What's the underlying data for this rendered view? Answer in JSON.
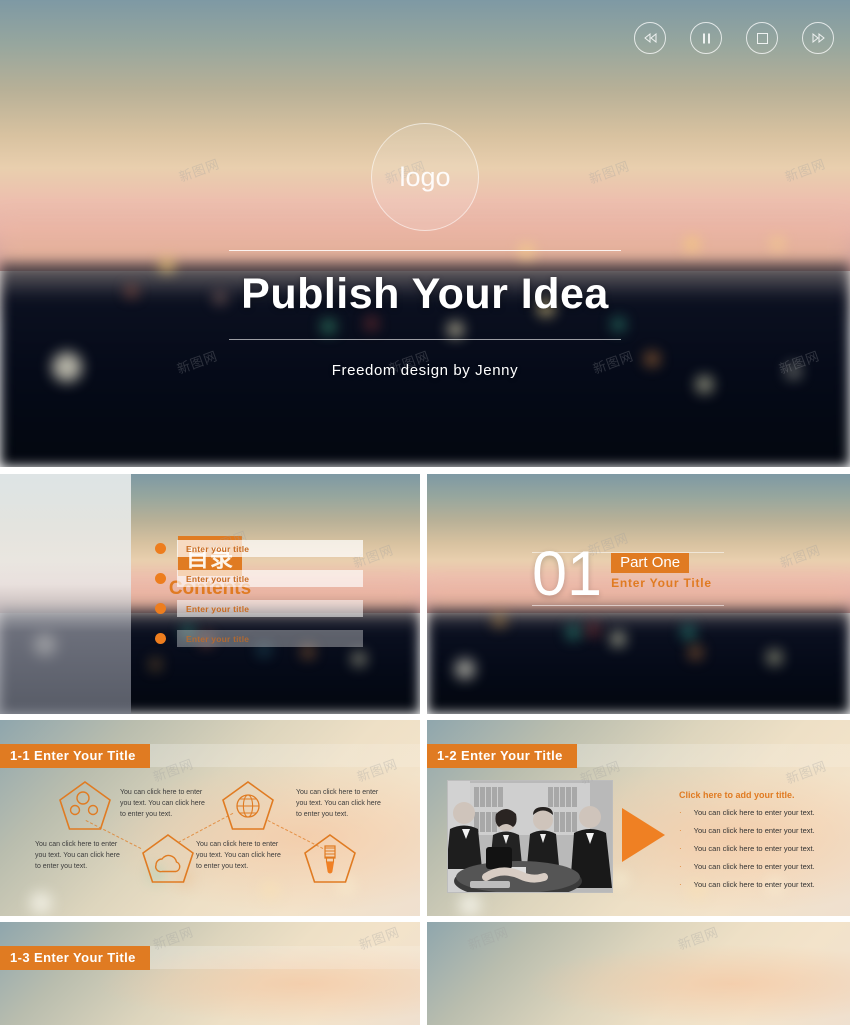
{
  "theme": {
    "accent": "#E07B22",
    "accent_bright": "#ED7D1E",
    "white": "#FFFFFF"
  },
  "watermark": {
    "text": "新图网"
  },
  "slides": {
    "title": {
      "logo": "logo",
      "heading": "Publish Your Idea",
      "subtitle": "Freedom  design  by  Jenny",
      "controls": [
        {
          "name": "rewind",
          "label": "Rewind"
        },
        {
          "name": "pause",
          "label": "Pause"
        },
        {
          "name": "stop",
          "label": "Stop"
        },
        {
          "name": "forward",
          "label": "Fast Forward"
        }
      ]
    },
    "contents": {
      "cn_label": "目录",
      "en_label": "Contents",
      "items": [
        {
          "label": "Enter your title"
        },
        {
          "label": "Enter your title"
        },
        {
          "label": "Enter your title"
        },
        {
          "label": "Enter your title"
        }
      ]
    },
    "part_one": {
      "number": "01",
      "tag": "Part One",
      "subtitle": "Enter  Your  Title"
    },
    "s11": {
      "title": "1-1 Enter  Your  Title",
      "nodes": [
        {
          "icon": "network-icon",
          "text": "You can click here to enter you text. You can click here to enter you text."
        },
        {
          "icon": "cloud-icon",
          "text": "You can click here to enter you text. You can click here to enter you text."
        },
        {
          "icon": "globe-icon",
          "text": "You can click here to enter you text. You can click here to enter you text."
        },
        {
          "icon": "bulb-icon",
          "text": "You can click here to enter you text. You can click here to enter you text."
        }
      ]
    },
    "s12": {
      "title": "1-2 Enter  Your  Title",
      "right_title": "Click here to add your title.",
      "bullets": [
        "You can click here to enter your text.",
        "You can click here to enter your text.",
        "You can click here to enter your text.",
        "You can click here to enter your text.",
        "You can click here to enter your text."
      ],
      "bullet_char": "·"
    },
    "s13": {
      "title": "1-3 Enter  Your  Title"
    },
    "blank": {
      "title": ""
    }
  }
}
